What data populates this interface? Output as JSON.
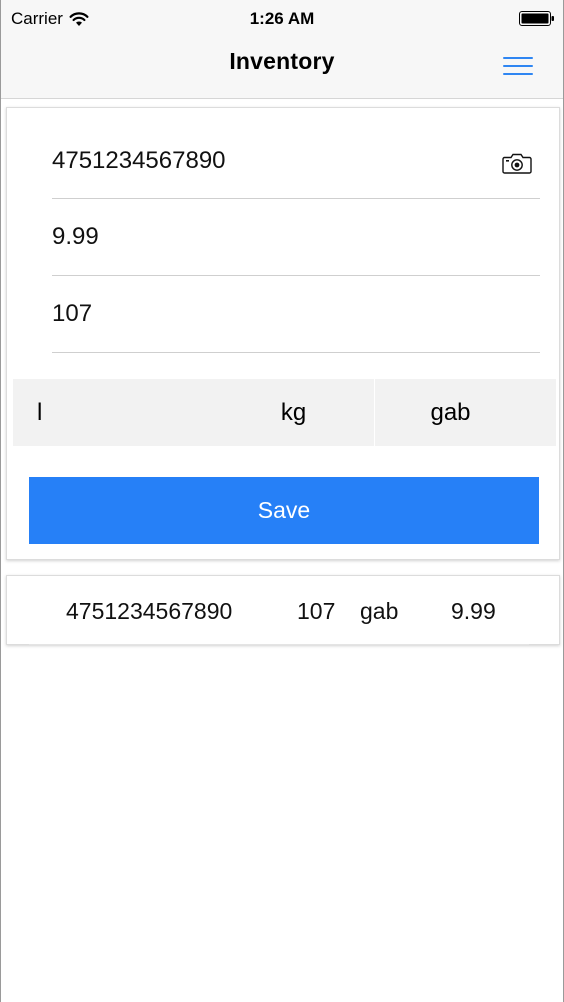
{
  "status_bar": {
    "carrier": "Carrier",
    "time": "1:26 AM",
    "wifi_icon": "wifi-icon",
    "battery_icon": "battery-icon"
  },
  "nav": {
    "title": "Inventory",
    "menu_icon": "hamburger-menu-icon"
  },
  "form": {
    "barcode_value": "4751234567890",
    "price_value": "9.99",
    "quantity_value": "107",
    "camera_icon": "camera-icon",
    "units": [
      "l",
      "kg",
      "gab"
    ],
    "save_label": "Save"
  },
  "items": [
    {
      "barcode": "4751234567890",
      "quantity": "107",
      "unit": "gab",
      "price": "9.99"
    }
  ],
  "colors": {
    "accent": "#2680f7",
    "menu_icon": "#2f86f2",
    "segment_background": "#f2f2f2",
    "nav_background": "#f7f7f7"
  }
}
